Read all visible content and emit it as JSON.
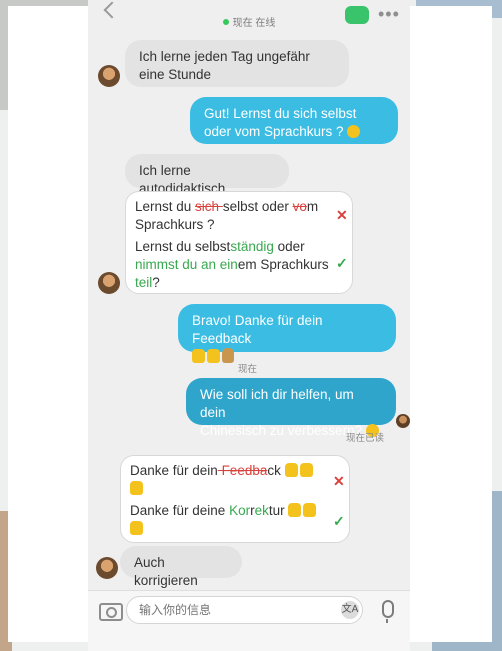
{
  "header": {
    "status_text": "现在 在线",
    "icons": [
      "back-icon",
      "video-call-icon",
      "more-icon"
    ],
    "online_color": "#35c95a"
  },
  "messages": {
    "m1": "Ich lerne jeden Tag ungefähr eine Stunde",
    "m2": "Gut! Lernst du sich selbst oder vom Sprachkurs ?",
    "m3": "Ich lerne autodidaktisch",
    "m5_line1": "Bravo! Danke für dein Feedback",
    "m6_line1": "Wie soll ich dir helfen, um dein",
    "m6_line2": "Chinesisch zu verbessern?",
    "m8": "Auch korrigieren"
  },
  "correction1": {
    "wrong_parts": [
      "Lernst du ",
      "sich ",
      "selbst oder ",
      "vo",
      "m",
      "Sprachkurs ?"
    ],
    "right_parts": [
      "Lernst du selbst",
      "ständig",
      " oder",
      "nimmst du an ein",
      "em Sprachkurs",
      "teil",
      "?"
    ]
  },
  "correction2": {
    "wrong_parts": [
      "Danke für dein",
      " Fee",
      "dba",
      "ck"
    ],
    "right_parts": [
      "Danke für deine ",
      "Kor",
      "r",
      "ek",
      "tur"
    ]
  },
  "timestamps": {
    "t1": "现在",
    "t2": "现在已读"
  },
  "input": {
    "placeholder": "输入你的信息",
    "translate_label": "文A"
  },
  "colors": {
    "incoming_bubble": "#e3e3e3",
    "outgoing_bubble": "#3bbde3",
    "correction_red": "#d9413c",
    "correction_green": "#39a84f"
  }
}
